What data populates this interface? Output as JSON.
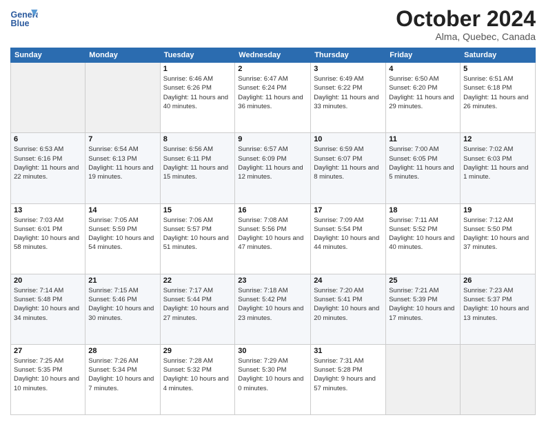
{
  "header": {
    "logo_text_general": "General",
    "logo_text_blue": "Blue",
    "month_title": "October 2024",
    "location": "Alma, Quebec, Canada"
  },
  "days_of_week": [
    "Sunday",
    "Monday",
    "Tuesday",
    "Wednesday",
    "Thursday",
    "Friday",
    "Saturday"
  ],
  "weeks": [
    [
      {
        "day": "",
        "info": ""
      },
      {
        "day": "",
        "info": ""
      },
      {
        "day": "1",
        "info": "Sunrise: 6:46 AM\nSunset: 6:26 PM\nDaylight: 11 hours and 40 minutes."
      },
      {
        "day": "2",
        "info": "Sunrise: 6:47 AM\nSunset: 6:24 PM\nDaylight: 11 hours and 36 minutes."
      },
      {
        "day": "3",
        "info": "Sunrise: 6:49 AM\nSunset: 6:22 PM\nDaylight: 11 hours and 33 minutes."
      },
      {
        "day": "4",
        "info": "Sunrise: 6:50 AM\nSunset: 6:20 PM\nDaylight: 11 hours and 29 minutes."
      },
      {
        "day": "5",
        "info": "Sunrise: 6:51 AM\nSunset: 6:18 PM\nDaylight: 11 hours and 26 minutes."
      }
    ],
    [
      {
        "day": "6",
        "info": "Sunrise: 6:53 AM\nSunset: 6:16 PM\nDaylight: 11 hours and 22 minutes."
      },
      {
        "day": "7",
        "info": "Sunrise: 6:54 AM\nSunset: 6:13 PM\nDaylight: 11 hours and 19 minutes."
      },
      {
        "day": "8",
        "info": "Sunrise: 6:56 AM\nSunset: 6:11 PM\nDaylight: 11 hours and 15 minutes."
      },
      {
        "day": "9",
        "info": "Sunrise: 6:57 AM\nSunset: 6:09 PM\nDaylight: 11 hours and 12 minutes."
      },
      {
        "day": "10",
        "info": "Sunrise: 6:59 AM\nSunset: 6:07 PM\nDaylight: 11 hours and 8 minutes."
      },
      {
        "day": "11",
        "info": "Sunrise: 7:00 AM\nSunset: 6:05 PM\nDaylight: 11 hours and 5 minutes."
      },
      {
        "day": "12",
        "info": "Sunrise: 7:02 AM\nSunset: 6:03 PM\nDaylight: 11 hours and 1 minute."
      }
    ],
    [
      {
        "day": "13",
        "info": "Sunrise: 7:03 AM\nSunset: 6:01 PM\nDaylight: 10 hours and 58 minutes."
      },
      {
        "day": "14",
        "info": "Sunrise: 7:05 AM\nSunset: 5:59 PM\nDaylight: 10 hours and 54 minutes."
      },
      {
        "day": "15",
        "info": "Sunrise: 7:06 AM\nSunset: 5:57 PM\nDaylight: 10 hours and 51 minutes."
      },
      {
        "day": "16",
        "info": "Sunrise: 7:08 AM\nSunset: 5:56 PM\nDaylight: 10 hours and 47 minutes."
      },
      {
        "day": "17",
        "info": "Sunrise: 7:09 AM\nSunset: 5:54 PM\nDaylight: 10 hours and 44 minutes."
      },
      {
        "day": "18",
        "info": "Sunrise: 7:11 AM\nSunset: 5:52 PM\nDaylight: 10 hours and 40 minutes."
      },
      {
        "day": "19",
        "info": "Sunrise: 7:12 AM\nSunset: 5:50 PM\nDaylight: 10 hours and 37 minutes."
      }
    ],
    [
      {
        "day": "20",
        "info": "Sunrise: 7:14 AM\nSunset: 5:48 PM\nDaylight: 10 hours and 34 minutes."
      },
      {
        "day": "21",
        "info": "Sunrise: 7:15 AM\nSunset: 5:46 PM\nDaylight: 10 hours and 30 minutes."
      },
      {
        "day": "22",
        "info": "Sunrise: 7:17 AM\nSunset: 5:44 PM\nDaylight: 10 hours and 27 minutes."
      },
      {
        "day": "23",
        "info": "Sunrise: 7:18 AM\nSunset: 5:42 PM\nDaylight: 10 hours and 23 minutes."
      },
      {
        "day": "24",
        "info": "Sunrise: 7:20 AM\nSunset: 5:41 PM\nDaylight: 10 hours and 20 minutes."
      },
      {
        "day": "25",
        "info": "Sunrise: 7:21 AM\nSunset: 5:39 PM\nDaylight: 10 hours and 17 minutes."
      },
      {
        "day": "26",
        "info": "Sunrise: 7:23 AM\nSunset: 5:37 PM\nDaylight: 10 hours and 13 minutes."
      }
    ],
    [
      {
        "day": "27",
        "info": "Sunrise: 7:25 AM\nSunset: 5:35 PM\nDaylight: 10 hours and 10 minutes."
      },
      {
        "day": "28",
        "info": "Sunrise: 7:26 AM\nSunset: 5:34 PM\nDaylight: 10 hours and 7 minutes."
      },
      {
        "day": "29",
        "info": "Sunrise: 7:28 AM\nSunset: 5:32 PM\nDaylight: 10 hours and 4 minutes."
      },
      {
        "day": "30",
        "info": "Sunrise: 7:29 AM\nSunset: 5:30 PM\nDaylight: 10 hours and 0 minutes."
      },
      {
        "day": "31",
        "info": "Sunrise: 7:31 AM\nSunset: 5:28 PM\nDaylight: 9 hours and 57 minutes."
      },
      {
        "day": "",
        "info": ""
      },
      {
        "day": "",
        "info": ""
      }
    ]
  ]
}
